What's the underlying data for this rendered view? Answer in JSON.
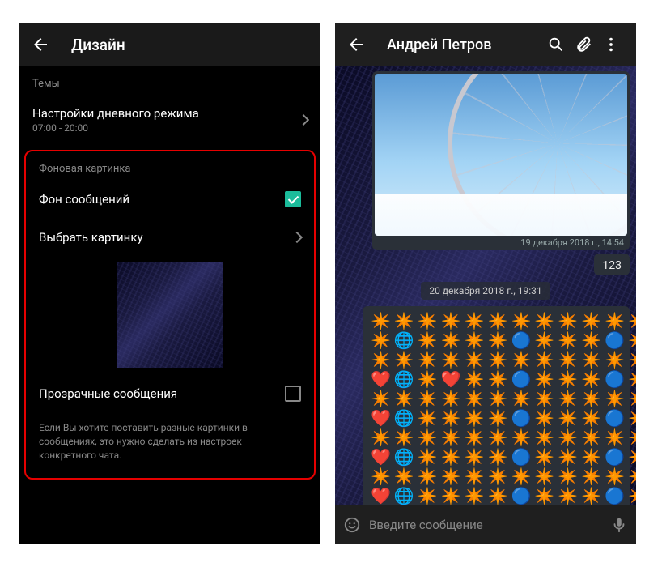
{
  "left": {
    "title": "Дизайн",
    "themes_label": "Темы",
    "day_mode": {
      "label": "Настройки дневного режима",
      "time": "07:00 - 20:00"
    },
    "bg_section": "Фоновая картинка",
    "msg_bg": "Фон сообщений",
    "choose_img": "Выбрать картинку",
    "transparent": "Прозрачные сообщения",
    "hint": "Если Вы хотите поставить разные картинки в сообщениях, это нужно сделать из настроек конкретного чата."
  },
  "right": {
    "contact": "Андрей Петров",
    "ts_image": "19 декабря 2018 г., 14:54",
    "date_chip": "20 декабря 2018 г., 19:31",
    "msg_123": "123",
    "input_placeholder": "Введите сообщение"
  },
  "emoji": {
    "star": "✴️",
    "globe": "🌐",
    "blue": "🔵",
    "heart": "❤️"
  }
}
